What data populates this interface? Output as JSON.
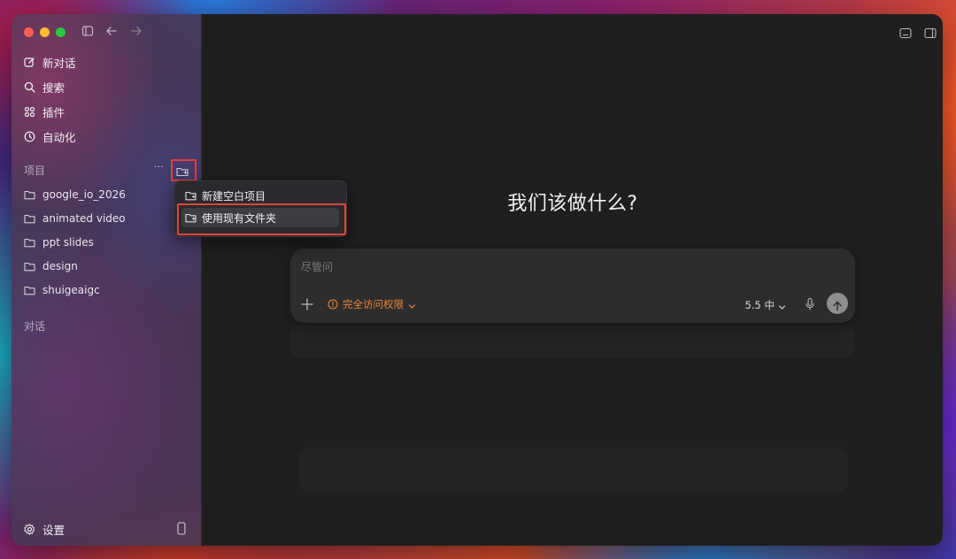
{
  "sidebar": {
    "nav": [
      {
        "label": "新对话",
        "icon": "compose-icon"
      },
      {
        "label": "搜索",
        "icon": "search-icon"
      },
      {
        "label": "插件",
        "icon": "plugins-icon"
      },
      {
        "label": "自动化",
        "icon": "clock-icon"
      }
    ],
    "projects_label": "项目",
    "more_label": "···",
    "projects": [
      {
        "label": "google_io_2026"
      },
      {
        "label": "animated video"
      },
      {
        "label": "ppt slides"
      },
      {
        "label": "design"
      },
      {
        "label": "shuigeaigc"
      }
    ],
    "conversations_label": "对话",
    "settings_label": "设置"
  },
  "context_menu": {
    "items": [
      {
        "label": "新建空白项目"
      },
      {
        "label": "使用现有文件夹",
        "selected": true
      }
    ]
  },
  "main": {
    "headline": "我们该做什么?",
    "composer": {
      "placeholder": "尽管问",
      "access_label": "完全访问权限",
      "model_label": "5.5 中"
    }
  },
  "colors": {
    "accent_orange": "#e8853c",
    "highlight_red": "#e0443c"
  }
}
